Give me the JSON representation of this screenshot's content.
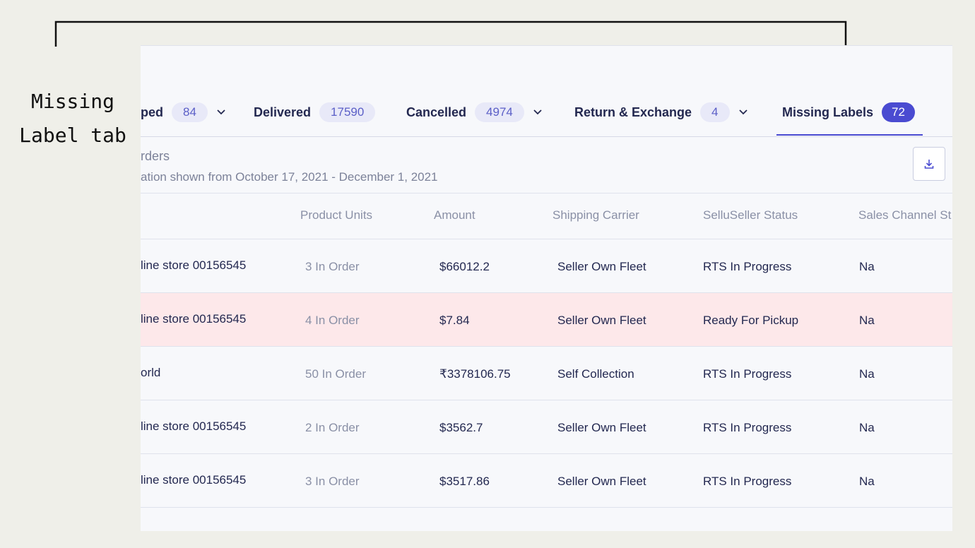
{
  "annotation": {
    "text": "Missing\nLabel tab"
  },
  "tabs": [
    {
      "label": "ped",
      "count": "84",
      "dropdown": true
    },
    {
      "label": "Delivered",
      "count": "17590",
      "dropdown": false
    },
    {
      "label": "Cancelled",
      "count": "4974",
      "dropdown": true
    },
    {
      "label": "Return & Exchange",
      "count": "4",
      "dropdown": true
    },
    {
      "label": "Missing Labels",
      "count": "72",
      "dropdown": false,
      "active": true
    }
  ],
  "section": {
    "title": "rders",
    "subtitle": "ation shown from October 17, 2021 - December 1, 2021",
    "download_icon": "download-icon"
  },
  "table": {
    "columns": [
      "Product Units",
      "Amount",
      "Shipping Carrier",
      "SelluSeller Status",
      "Sales Channel St"
    ],
    "rows": [
      {
        "store": "line store 00156545",
        "units": "3 In Order",
        "amount": "$66012.2",
        "carrier": "Seller Own Fleet",
        "status": "RTS In Progress",
        "channel": "Na",
        "highlight": false
      },
      {
        "store": "line store 00156545",
        "units": "4 In Order",
        "amount": "$7.84",
        "carrier": "Seller Own Fleet",
        "status": "Ready For Pickup",
        "channel": "Na",
        "highlight": true
      },
      {
        "store": "orld",
        "units": "50 In Order",
        "amount": "₹3378106.75",
        "carrier": "Self Collection",
        "status": "RTS In Progress",
        "channel": "Na",
        "highlight": false
      },
      {
        "store": "line store 00156545",
        "units": "2 In Order",
        "amount": "$3562.7",
        "carrier": "Seller Own Fleet",
        "status": "RTS In Progress",
        "channel": "Na",
        "highlight": false
      },
      {
        "store": "line store 00156545",
        "units": "3 In Order",
        "amount": "$3517.86",
        "carrier": "Seller Own Fleet",
        "status": "RTS In Progress",
        "channel": "Na",
        "highlight": false
      }
    ]
  },
  "colors": {
    "accent": "#4a4bd1",
    "alert_row": "#fde8ea",
    "badge_bg": "#e8e9f8"
  }
}
